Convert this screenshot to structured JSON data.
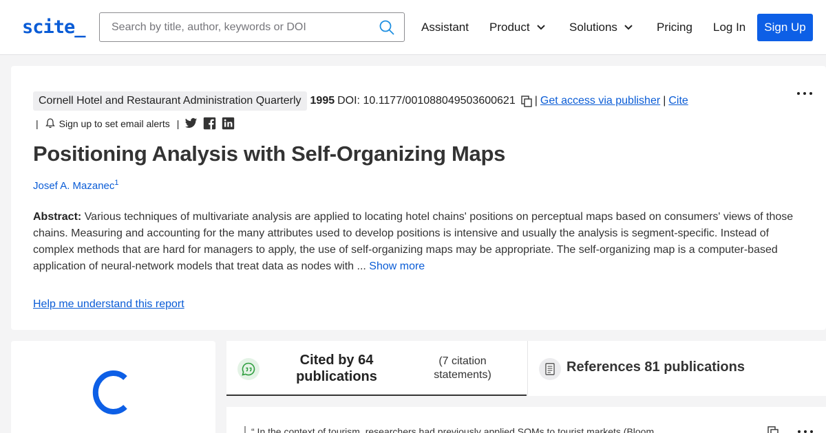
{
  "header": {
    "logo": "scite_",
    "search_placeholder": "Search by title, author, keywords or DOI",
    "nav": {
      "assistant": "Assistant",
      "product": "Product",
      "solutions": "Solutions",
      "pricing": "Pricing",
      "login": "Log In",
      "signup": "Sign Up"
    }
  },
  "paper": {
    "journal": "Cornell Hotel and Restaurant Administration Quarterly",
    "year": "1995",
    "doi": "DOI: 10.1177/001088049503600621",
    "access_link": "Get access via publisher",
    "cite_link": "Cite",
    "sep": "|",
    "alerts": "Sign up to set email alerts",
    "title": "Positioning Analysis with Self-Organizing Maps",
    "author": "Josef A. Mazanec",
    "author_sup": "1",
    "abstract_label": "Abstract:",
    "abstract_text": "Various techniques of multivariate analysis are applied to locating hotel chains' positions on perceptual maps based on consumers' views of those chains. Measuring and accounting for the many attributes used to develop positions is intensive and usually the analysis is segment-specific. Instead of complex methods that are hard for managers to apply, the use of self-organizing maps may be appropriate. The self-organizing map is a computer-based application of neural-network models that treat data as nodes with ...",
    "show_more": "Show more",
    "help_link": "Help me understand this report"
  },
  "tabs": {
    "cited_by": "Cited by 64 publications",
    "statements": "(7 citation statements)",
    "references": "References 81 publications"
  },
  "citation": {
    "quote": "“ In the context of tourism, researchers had previously applied SOMs to tourist markets (Bloom,"
  },
  "colors": {
    "accent": "#0d5fe6",
    "link": "#0a5cd6",
    "chat_green": "#2e9e3e"
  }
}
